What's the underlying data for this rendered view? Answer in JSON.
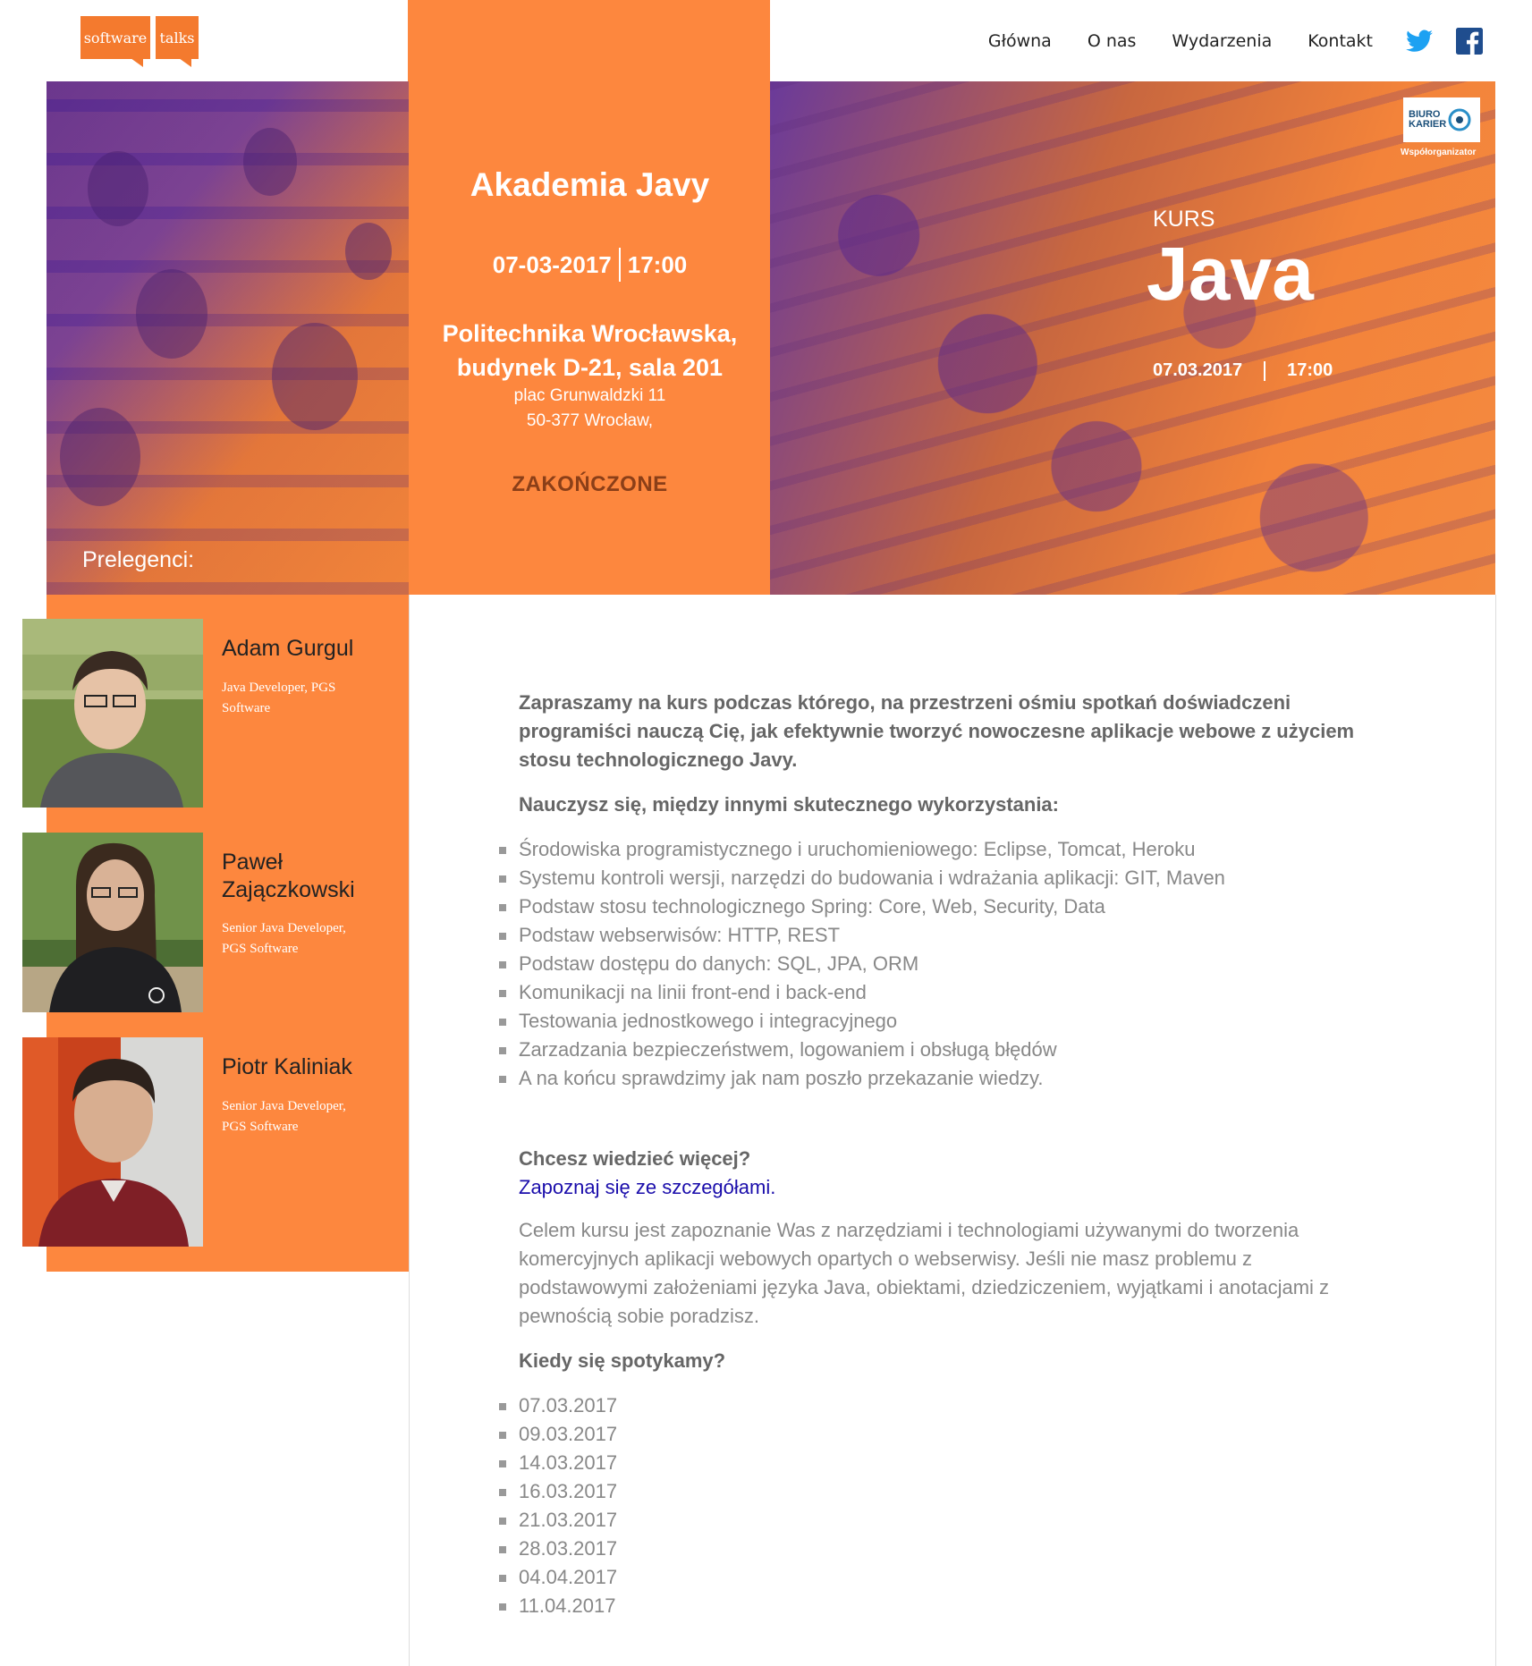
{
  "header": {
    "logo": {
      "part1": "software",
      "part2": "talks"
    },
    "nav": [
      {
        "label": "Główna"
      },
      {
        "label": "O nas"
      },
      {
        "label": "Wydarzenia"
      },
      {
        "label": "Kontakt"
      }
    ]
  },
  "hero": {
    "title": "Akademia Javy",
    "date": "07-03-2017",
    "time": "17:00",
    "place_line1": "Politechnika Wrocławska,",
    "place_line2": "budynek D-21, sala 201",
    "address_line1": "plac Grunwaldzki 11",
    "address_line2": "50-377 Wrocław,",
    "status": "ZAKOŃCZONE",
    "speakers_label": "Prelegenci:",
    "banner": {
      "kurs": "KURS",
      "name": "Java",
      "date": "07.03.2017",
      "time": "17:00",
      "partner_line1": "BIURO",
      "partner_line2": "KARIER",
      "partner_role": "Współorganizator"
    }
  },
  "speakers": [
    {
      "name": "Adam Gurgul",
      "role": "Java Developer, PGS Software"
    },
    {
      "name": "Paweł Zajączkowski",
      "role": "Senior Java Developer, PGS Software"
    },
    {
      "name": "Piotr Kaliniak",
      "role": "Senior Java Developer, PGS Software"
    }
  ],
  "content": {
    "intro": "Zapraszamy na kurs podczas którego, na przestrzeni ośmiu spotkań doświadczeni programiści nauczą Cię, jak efektywnie tworzyć nowoczesne aplikacje webowe z użyciem stosu technologicznego Javy.",
    "learn_heading": "Nauczysz się, między innymi skutecznego wykorzystania:",
    "learn_items": [
      "Środowiska programistycznego i uruchomieniowego: Eclipse, Tomcat, Heroku",
      "Systemu kontroli wersji, narzędzi do budowania i wdrażania aplikacji: GIT, Maven",
      "Podstaw stosu technologicznego Spring: Core, Web, Security, Data",
      "Podstaw webserwisów: HTTP, REST",
      "Podstaw dostępu do danych: SQL, JPA, ORM",
      "Komunikacji na linii front-end i back-end",
      "Testowania jednostkowego i integracyjnego",
      "Zarzadzania bezpieczeństwem, logowaniem i obsługą błędów",
      "A na końcu sprawdzimy jak nam poszło przekazanie wiedzy."
    ],
    "more_heading": "Chcesz wiedzieć więcej?",
    "more_link": "Zapoznaj się ze szczegółami.",
    "goal": "Celem kursu jest zapoznanie Was z narzędziami i technologiami używanymi do tworzenia komercyjnych aplikacji webowych opartych o webserwisy. Jeśli nie masz problemu z podstawowymi założeniami języka Java, obiektami, dziedziczeniem, wyjątkami i anotacjami z pewnością sobie poradzisz.",
    "when_heading": "Kiedy się spotykamy?",
    "dates": [
      "07.03.2017",
      "09.03.2017",
      "14.03.2017",
      "16.03.2017",
      "21.03.2017",
      "28.03.2017",
      "04.04.2017",
      "11.04.2017"
    ]
  },
  "colors": {
    "brand_orange": "#fd873e",
    "status_brown": "#8b3f18",
    "twitter": "#1da1f2",
    "facebook": "#1f4d8e",
    "link": "#1a0dab"
  },
  "icons": [
    "twitter-icon",
    "facebook-icon"
  ]
}
